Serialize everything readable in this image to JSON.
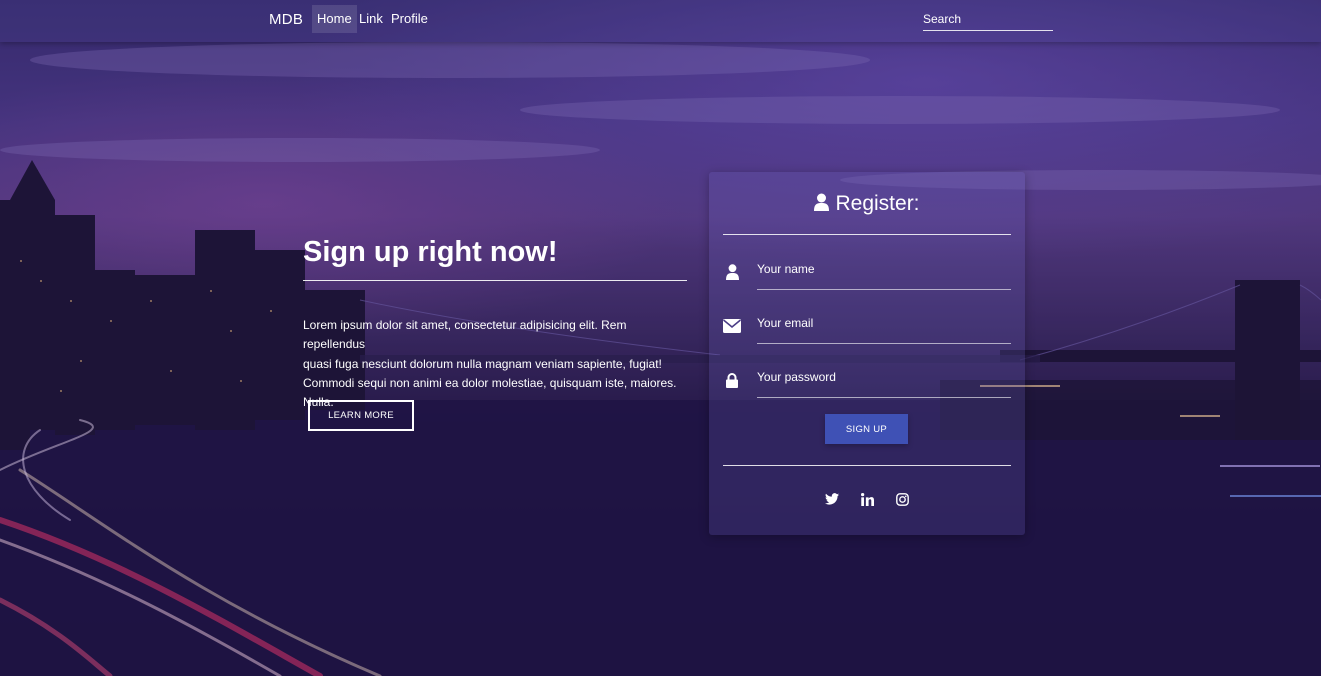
{
  "navbar": {
    "brand": "MDB",
    "items": [
      {
        "label": "Home",
        "active": true
      },
      {
        "label": "Link",
        "active": false
      },
      {
        "label": "Profile",
        "active": false
      }
    ],
    "search_placeholder": "Search"
  },
  "hero": {
    "title": "Sign up right now!",
    "text_lines": [
      "Lorem ipsum dolor sit amet, consectetur adipisicing elit. Rem repellendus",
      "quasi fuga nesciunt dolorum nulla magnam veniam sapiente, fugiat!",
      "Commodi sequi non animi ea dolor molestiae, quisquam iste, maiores. Nulla."
    ],
    "button_label": "LEARN MORE"
  },
  "register": {
    "title": "Register:",
    "title_icon": "user-icon",
    "fields": [
      {
        "label": "Your name",
        "icon": "user-icon"
      },
      {
        "label": "Your email",
        "icon": "envelope-icon"
      },
      {
        "label": "Your password",
        "icon": "lock-icon"
      }
    ],
    "button_label": "SIGN UP",
    "social": [
      "twitter-icon",
      "linkedin-icon",
      "instagram-icon"
    ]
  },
  "colors": {
    "primary": "#3f51b5",
    "text": "#ffffff"
  }
}
